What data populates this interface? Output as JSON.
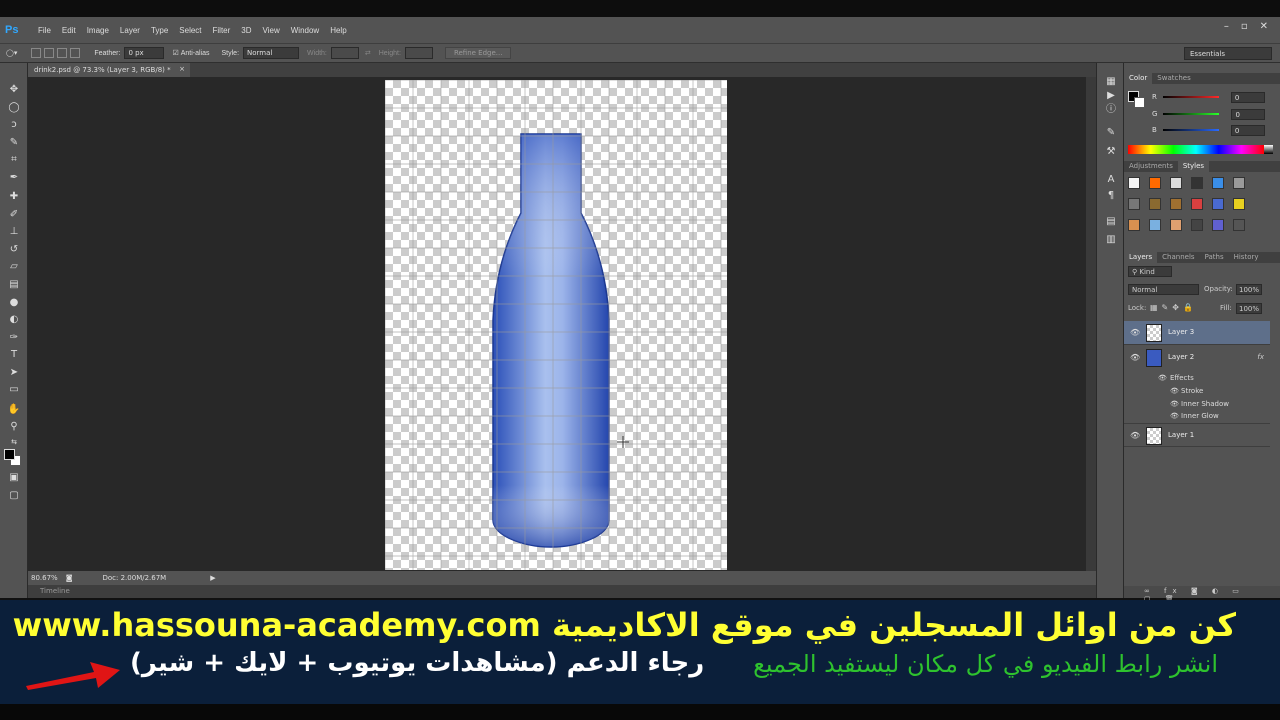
{
  "app": {
    "logo": "Ps",
    "menu": [
      "File",
      "Edit",
      "Image",
      "Layer",
      "Type",
      "Select",
      "Filter",
      "3D",
      "View",
      "Window",
      "Help"
    ],
    "window_controls": [
      "–",
      "▫",
      "✕"
    ]
  },
  "options_bar": {
    "feather_label": "Feather:",
    "feather_value": "0 px",
    "antialias_label": "Anti-alias",
    "style_label": "Style:",
    "style_value": "Normal",
    "width_label": "Width:",
    "height_label": "Height:",
    "refine_label": "Refine Edge...",
    "workspace": "Essentials"
  },
  "document": {
    "tab_title": "drink2.psd @ 73.3% (Layer 3, RGB/8) *",
    "zoom": "80.67%",
    "doc_size": "Doc: 2.00M/2.67M",
    "timeline_label": "Timeline"
  },
  "color_panel": {
    "tabs": [
      "Color",
      "Swatches"
    ],
    "channels": [
      {
        "label": "R",
        "value": "0",
        "color": "#ff2a2a"
      },
      {
        "label": "G",
        "value": "0",
        "color": "#2aff2a"
      },
      {
        "label": "B",
        "value": "0",
        "color": "#2a6aff"
      }
    ]
  },
  "styles_panel": {
    "tabs": [
      "Adjustments",
      "Styles"
    ]
  },
  "layers_panel": {
    "tabs": [
      "Layers",
      "Channels",
      "Paths",
      "History"
    ],
    "kind_label": "Kind",
    "blend_mode": "Normal",
    "opacity_label": "Opacity:",
    "opacity_value": "100%",
    "lock_label": "Lock:",
    "fill_label": "Fill:",
    "fill_value": "100%",
    "layers": [
      {
        "name": "Layer 3",
        "selected": true
      },
      {
        "name": "Layer 2",
        "fx": "fx"
      },
      {
        "name": "Layer 1"
      }
    ],
    "effects_label": "Effects",
    "effects": [
      "Stroke",
      "Inner Shadow",
      "Inner Glow"
    ]
  },
  "banner": {
    "line1": "كن من اوائل المسجلين في موقع الاكاديمية www.hassouna-academy.com",
    "line2_support": "رجاء الدعم (مشاهدات يوتيوب + لايك + شير)",
    "line2_share": "انشر رابط الفيديو في كل مكان ليستفيد الجميع",
    "arrow_color": "#e01515"
  }
}
